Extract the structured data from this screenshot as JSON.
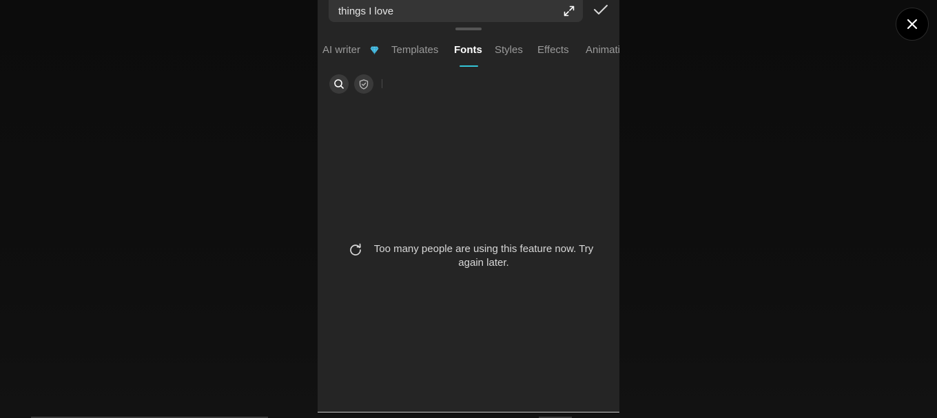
{
  "editor": {
    "text_value": "things I love"
  },
  "tabs": [
    {
      "label": "AI writer"
    },
    {
      "label": "Templates"
    },
    {
      "label": "Fonts"
    },
    {
      "label": "Styles"
    },
    {
      "label": "Effects"
    },
    {
      "label": "Animati"
    }
  ],
  "active_tab": "Fonts",
  "message": {
    "text": "Too many people are using this feature now. Try again later."
  },
  "colors": {
    "accent": "#34c6d8",
    "panel": "#252525",
    "premium_gem": "#4fc3e8"
  },
  "icons": {
    "close": "close-icon",
    "expand": "expand-icon",
    "confirm": "checkmark-icon",
    "premium": "gem-icon",
    "search": "search-icon",
    "favorites": "shield-check-icon",
    "retry": "refresh-icon"
  }
}
